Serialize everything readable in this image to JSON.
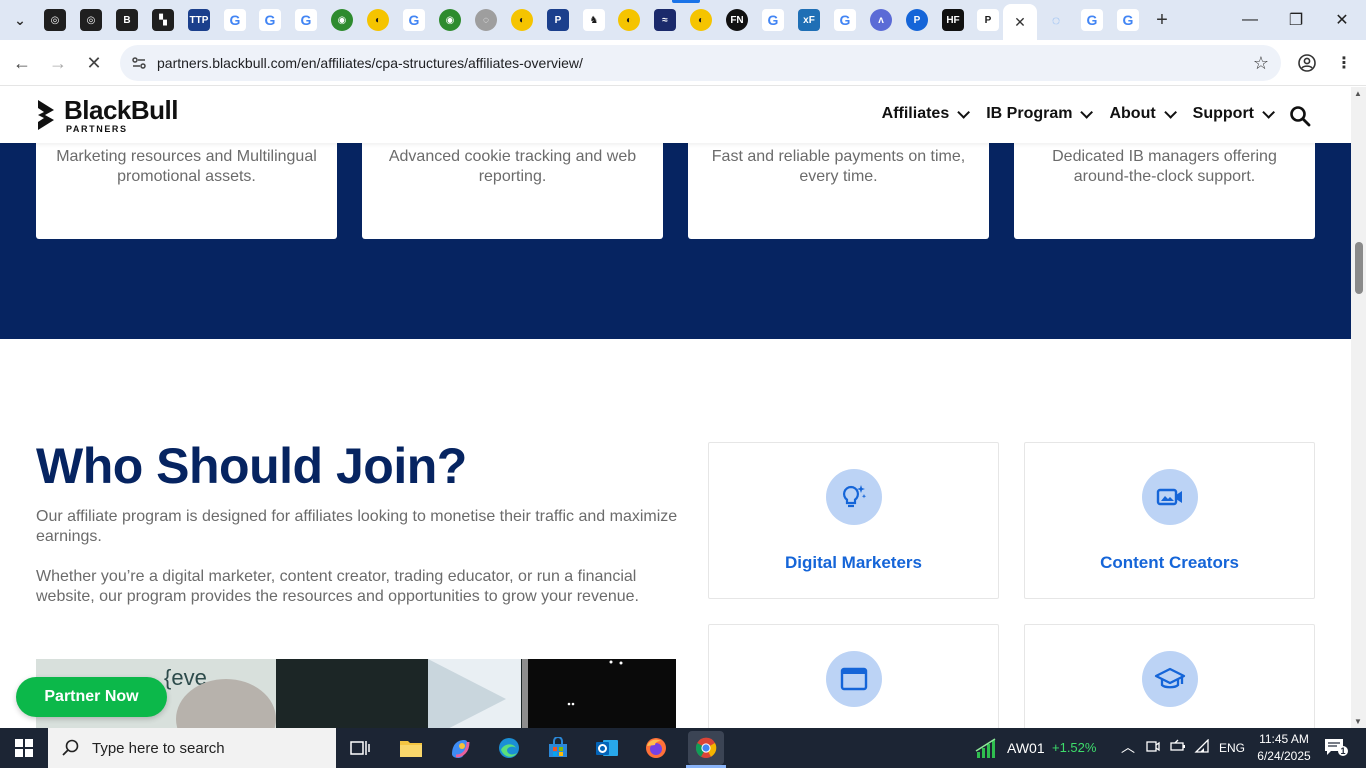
{
  "browser": {
    "tabs": {
      "favicons": [
        {
          "icon": "chatgpt-icon",
          "bg": "#1f1f1f",
          "glyph": "◎"
        },
        {
          "icon": "chatgpt-icon",
          "bg": "#1f1f1f",
          "glyph": "◎"
        },
        {
          "icon": "bold-b-icon",
          "bg": "#1f1f1f",
          "glyph": "B"
        },
        {
          "icon": "chart-icon",
          "bg": "#1f1f1f",
          "glyph": "▚"
        },
        {
          "icon": "ttp-icon",
          "bg": "#1b3f8c",
          "glyph": "TTP"
        },
        {
          "icon": "google-icon",
          "bg": "#ffffff",
          "glyph": "G"
        },
        {
          "icon": "google-icon",
          "bg": "#ffffff",
          "glyph": "G"
        },
        {
          "icon": "google-icon",
          "bg": "#ffffff",
          "glyph": "G"
        },
        {
          "icon": "globe-green-icon",
          "bg": "#2e8b2e",
          "glyph": "◉"
        },
        {
          "icon": "yellow-logo-icon",
          "bg": "#f5c400",
          "glyph": "◐"
        },
        {
          "icon": "google-icon",
          "bg": "#ffffff",
          "glyph": "G"
        },
        {
          "icon": "globe-green-icon",
          "bg": "#2e8b2e",
          "glyph": "◉"
        },
        {
          "icon": "globe-grey-icon",
          "bg": "#9e9e9e",
          "glyph": "◌"
        },
        {
          "icon": "yellow-logo-icon",
          "bg": "#f5c400",
          "glyph": "◐"
        },
        {
          "icon": "p-icon",
          "bg": "#1b3f8c",
          "glyph": "P"
        },
        {
          "icon": "bull-icon",
          "bg": "#ffffff",
          "glyph": "♞"
        },
        {
          "icon": "yellow-logo-icon",
          "bg": "#f5c400",
          "glyph": "◐"
        },
        {
          "icon": "wave-icon",
          "bg": "#1b2a6b",
          "glyph": "≈"
        },
        {
          "icon": "yellow-logo-icon",
          "bg": "#f5c400",
          "glyph": "◐"
        },
        {
          "icon": "fn-icon",
          "bg": "#111111",
          "glyph": "FN"
        },
        {
          "icon": "google-icon",
          "bg": "#ffffff",
          "glyph": "G"
        },
        {
          "icon": "xf-icon",
          "bg": "#1f6fb5",
          "glyph": "xF"
        },
        {
          "icon": "google-icon",
          "bg": "#ffffff",
          "glyph": "G"
        },
        {
          "icon": "awa-icon",
          "bg": "#5b6bd6",
          "glyph": "ʌ"
        },
        {
          "icon": "p-circle-icon",
          "bg": "#1565d8",
          "glyph": "P"
        },
        {
          "icon": "hf-icon",
          "bg": "#111111",
          "glyph": "HF"
        },
        {
          "icon": "pepperstone-icon",
          "bg": "#ffffff",
          "glyph": "P"
        }
      ],
      "after_active": [
        {
          "icon": "loading-icon",
          "bg": "#dfe7f4",
          "glyph": "◌"
        },
        {
          "icon": "google-icon",
          "bg": "#ffffff",
          "glyph": "G"
        },
        {
          "icon": "google-icon",
          "bg": "#ffffff",
          "glyph": "G"
        }
      ],
      "active_close": "✕",
      "new_tab": "+"
    },
    "window": {
      "minimize": "—",
      "restore": "❐",
      "close": "✕"
    },
    "address": {
      "url": "partners.blackbull.com/en/affiliates/cpa-structures/affiliates-overview/"
    }
  },
  "site": {
    "logo": {
      "main": "BlackBull",
      "sub": "PARTNERS"
    },
    "menu": [
      {
        "label": "Affiliates"
      },
      {
        "label": "IB Program"
      },
      {
        "label": "About"
      },
      {
        "label": "Support"
      }
    ],
    "feature_cards": [
      {
        "text": "Marketing resources and Multilingual promotional assets."
      },
      {
        "text": "Advanced cookie tracking and web reporting."
      },
      {
        "text": "Fast and reliable payments on time, every time."
      },
      {
        "text": "Dedicated IB managers offering around-the-clock support."
      }
    ],
    "who": {
      "title": "Who Should Join?",
      "p1": "Our affiliate program is designed for affiliates looking to monetise their traffic and maximize earnings.",
      "p2": "Whether you’re a digital marketer, content creator, trading educator, or run a financial website, our program provides the resources and opportunities to grow your revenue.",
      "cards": [
        {
          "label": "Digital Marketers",
          "icon": "lightbulb-icon"
        },
        {
          "label": "Content Creators",
          "icon": "video-camera-icon"
        },
        {
          "label": "",
          "icon": "browser-window-icon"
        },
        {
          "label": "",
          "icon": "graduation-cap-icon"
        }
      ]
    },
    "cta": {
      "label": "Partner Now"
    }
  },
  "colors": {
    "navy": "#062461",
    "accent_blue": "#1565d8",
    "cta_green": "#0cb84a",
    "icon_bg": "#bcd3f5"
  },
  "taskbar": {
    "search_placeholder": "Type here to search",
    "ticker": {
      "symbol": "AW01",
      "change": "+1.52%"
    },
    "language": "ENG",
    "time": "11:45 AM",
    "date": "6/24/2025",
    "notifications": "1"
  }
}
